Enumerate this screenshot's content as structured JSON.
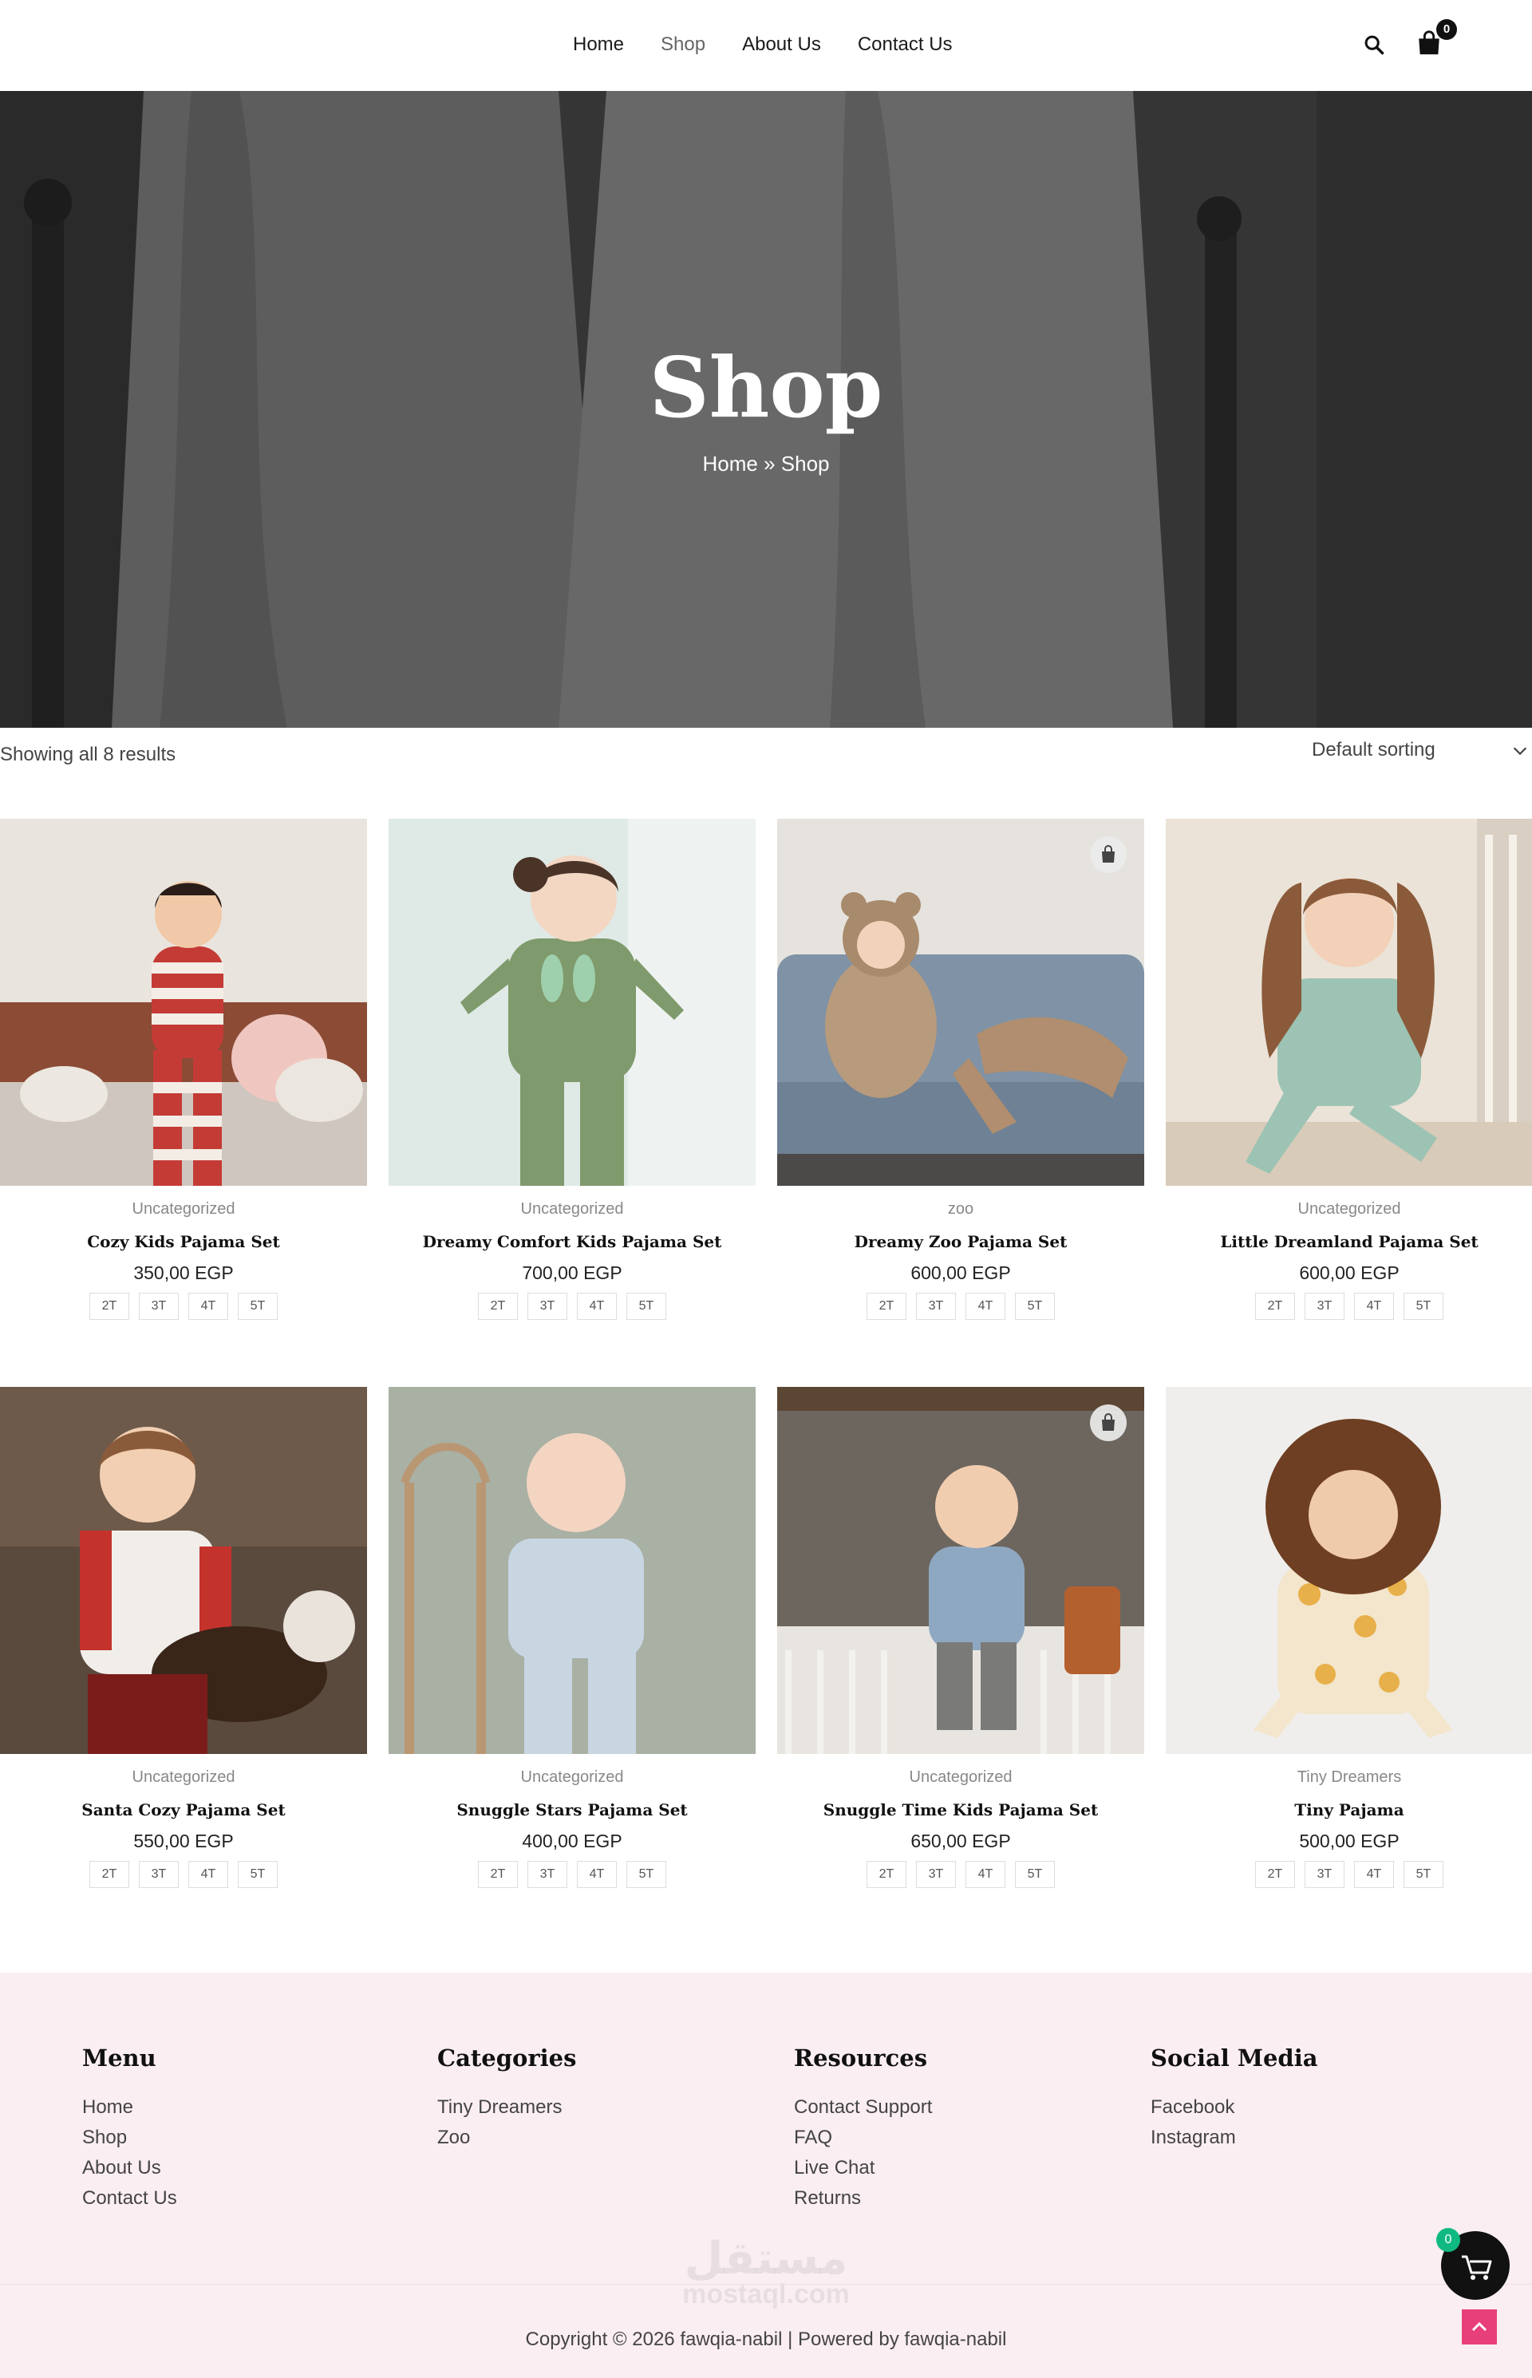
{
  "header": {
    "nav": [
      "Home",
      "Shop",
      "About Us",
      "Contact Us"
    ],
    "active_nav": "Shop",
    "cart_count": "0"
  },
  "hero": {
    "title": "Shop",
    "breadcrumb": "Home » Shop"
  },
  "toolbar": {
    "result_count": "Showing all 8 results",
    "sort_selected": "Default sorting"
  },
  "products": [
    {
      "category": "Uncategorized",
      "name": "Cozy Kids Pajama Set",
      "price": "350,00 EGP",
      "sizes": [
        "2T",
        "3T",
        "4T",
        "5T"
      ],
      "bag_badge": false
    },
    {
      "category": "Uncategorized",
      "name": "Dreamy Comfort Kids Pajama Set",
      "price": "700,00 EGP",
      "sizes": [
        "2T",
        "3T",
        "4T",
        "5T"
      ],
      "bag_badge": false
    },
    {
      "category": "zoo",
      "name": "Dreamy Zoo Pajama Set",
      "price": "600,00 EGP",
      "sizes": [
        "2T",
        "3T",
        "4T",
        "5T"
      ],
      "bag_badge": true
    },
    {
      "category": "Uncategorized",
      "name": "Little Dreamland Pajama Set",
      "price": "600,00 EGP",
      "sizes": [
        "2T",
        "3T",
        "4T",
        "5T"
      ],
      "bag_badge": false
    },
    {
      "category": "Uncategorized",
      "name": "Santa Cozy Pajama Set",
      "price": "550,00 EGP",
      "sizes": [
        "2T",
        "3T",
        "4T",
        "5T"
      ],
      "bag_badge": false
    },
    {
      "category": "Uncategorized",
      "name": "Snuggle Stars Pajama Set",
      "price": "400,00 EGP",
      "sizes": [
        "2T",
        "3T",
        "4T",
        "5T"
      ],
      "bag_badge": false
    },
    {
      "category": "Uncategorized",
      "name": "Snuggle Time Kids Pajama Set",
      "price": "650,00 EGP",
      "sizes": [
        "2T",
        "3T",
        "4T",
        "5T"
      ],
      "bag_badge": true
    },
    {
      "category": "Tiny Dreamers",
      "name": "Tiny Pajama",
      "price": "500,00 EGP",
      "sizes": [
        "2T",
        "3T",
        "4T",
        "5T"
      ],
      "bag_badge": false
    }
  ],
  "footer": {
    "columns": [
      {
        "title": "Menu",
        "links": [
          "Home",
          "Shop",
          "About Us",
          "Contact Us"
        ]
      },
      {
        "title": "Categories",
        "links": [
          "Tiny Dreamers",
          "Zoo"
        ]
      },
      {
        "title": "Resources",
        "links": [
          "Contact Support",
          "FAQ",
          "Live Chat",
          "Returns"
        ]
      },
      {
        "title": "Social Media",
        "links": [
          "Facebook",
          "Instagram"
        ]
      }
    ],
    "copyright": "Copyright © 2026 fawqia-nabil | Powered by fawqia-nabil",
    "watermark": "مستقل",
    "watermark_sub": "mostaql.com",
    "float_cart_count": "0"
  },
  "colors": {
    "footer_bg": "#fbeef3",
    "accent_pink": "#e83e7a",
    "cart_badge_green": "#10b981"
  }
}
